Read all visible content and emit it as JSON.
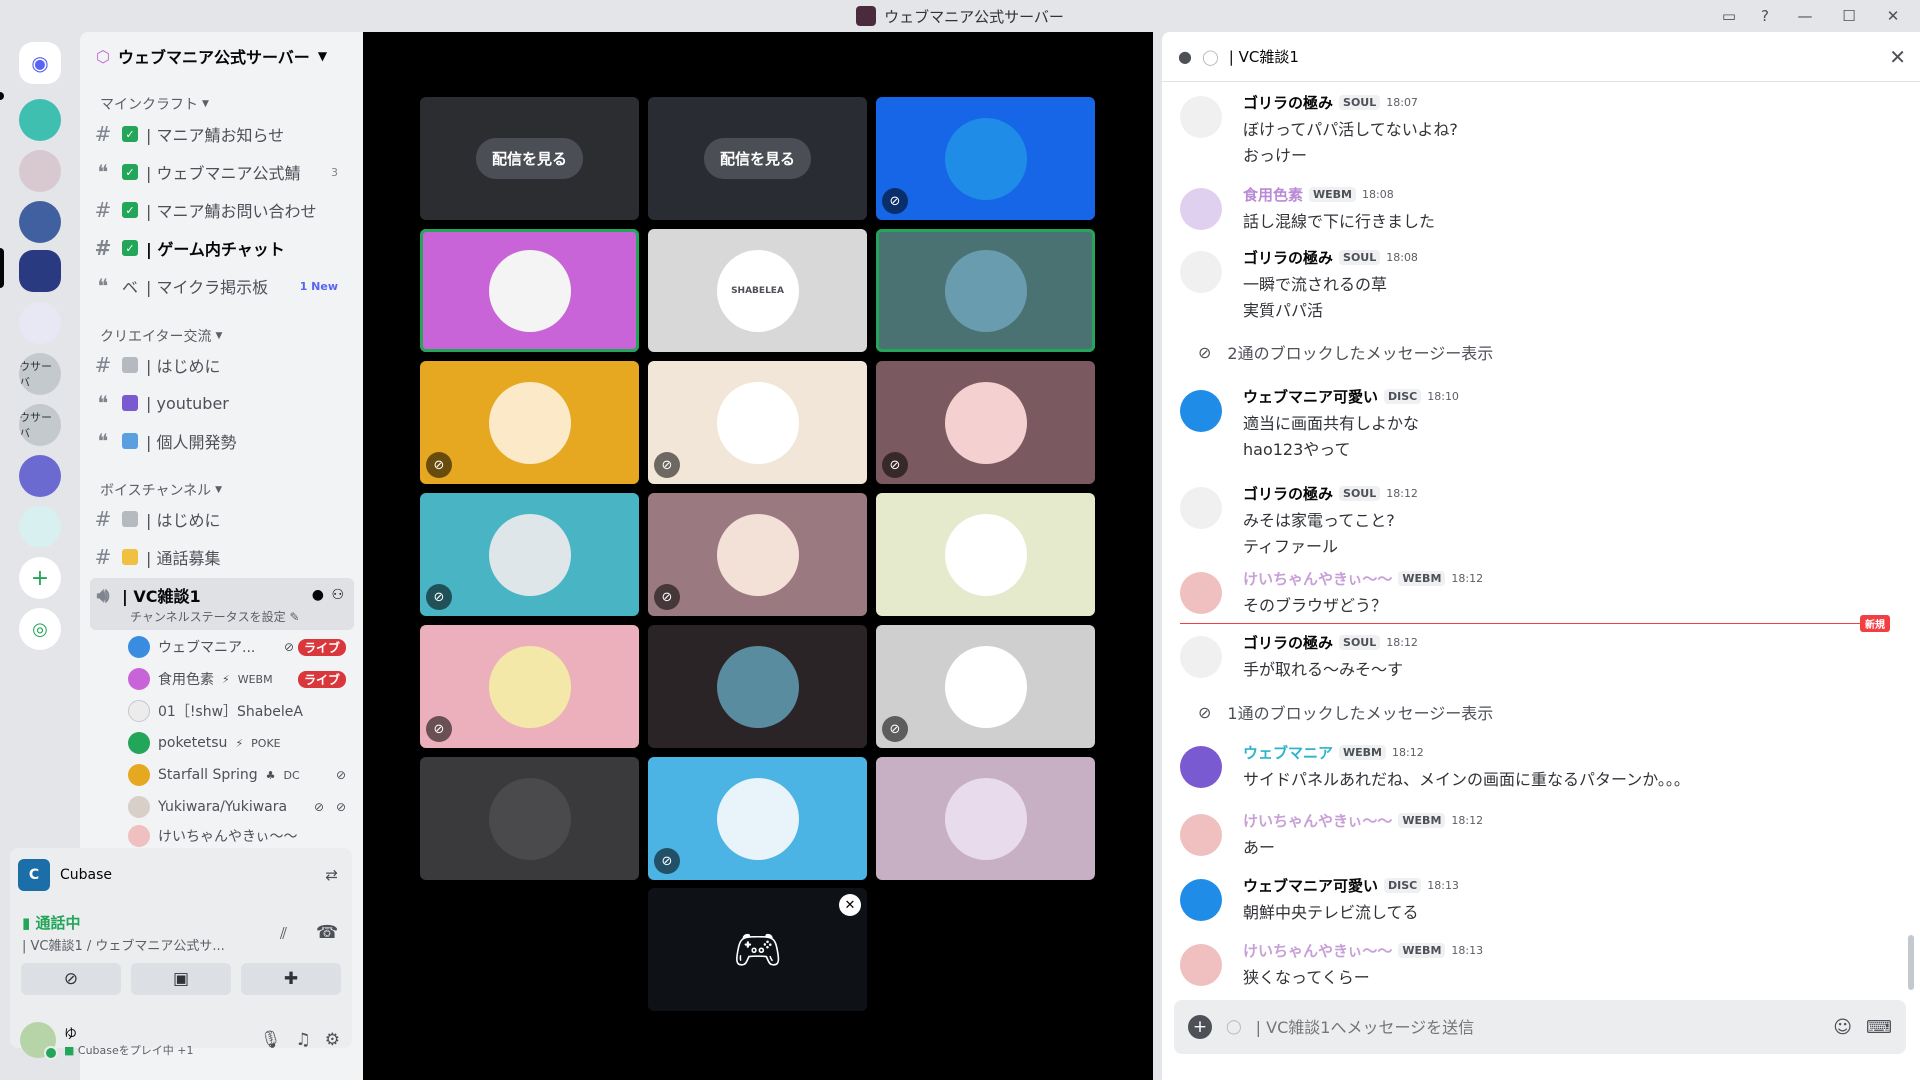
{
  "window": {
    "title": "ウェブマニア公式サーバー"
  },
  "rail": {
    "labels": [
      "ウサーバ",
      "ウサーバ"
    ]
  },
  "server": {
    "name": "ウェブマニア公式サーバー"
  },
  "categories": {
    "minecraft": "マインクラフト",
    "creator": "クリエイター交流",
    "voice": "ボイスチャンネル"
  },
  "channels": [
    {
      "label": "| マニア鯖お知らせ",
      "icon": "hash",
      "check": true
    },
    {
      "label": "| ウェブマニア公式鯖",
      "icon": "forum",
      "check": true,
      "count": "3"
    },
    {
      "label": "| マニア鯖お問い合わせ",
      "icon": "hash",
      "check": true
    },
    {
      "label": "| ゲーム内チャット",
      "icon": "hash",
      "check": true
    },
    {
      "label": "| マイクラ掲示板",
      "icon": "forum",
      "prefix": "ベ",
      "new": "1 New"
    },
    {
      "label": "| はじめに",
      "icon": "hash"
    },
    {
      "label": "| youtuber",
      "icon": "forum"
    },
    {
      "label": "| 個人開発勢",
      "icon": "forum"
    },
    {
      "label": "| はじめに",
      "icon": "hash"
    },
    {
      "label": "| 通話募集",
      "icon": "hash"
    }
  ],
  "voice_channel": {
    "name": "| VC雑談1",
    "status": "チャンネルステータスを設定"
  },
  "voice_users": [
    {
      "name": "ウェブマニア...",
      "live": "ライブ"
    },
    {
      "name": "食用色素",
      "tag": "WEBM",
      "live": "ライブ"
    },
    {
      "name": "01［!shw］ShabeleA"
    },
    {
      "name": "poketetsu",
      "tag": "POKE"
    },
    {
      "name": "Starfall Spring",
      "tag": "DC"
    },
    {
      "name": "Yukiwara/Yukiwara"
    },
    {
      "name": "けいちゃんやきぃ〜〜"
    }
  ],
  "activity": {
    "app": "Cubase"
  },
  "connection": {
    "status": "通話中",
    "channel": "| VC雑談1 / ウェブマニア公式サ..."
  },
  "user": {
    "name": "ゆ",
    "activity": "Cubaseをプレイ中 +1"
  },
  "stage": {
    "watch_label": "配信を見る",
    "tiles": [
      {
        "bg": "#2b2d31",
        "type": "watch"
      },
      {
        "bg": "#2a2c33",
        "type": "watch"
      },
      {
        "bg": "#1766e8",
        "type": "avatar",
        "avbg": "#1f8ce8",
        "mute": true
      },
      {
        "bg": "#c864d8",
        "type": "avatar",
        "avbg": "#f4f4f4",
        "speaking": true
      },
      {
        "bg": "#d8d8d8",
        "type": "avatar",
        "avbg": "#ffffff",
        "text": "SHABELEA"
      },
      {
        "bg": "#4a7272",
        "type": "avatar",
        "avbg": "#6a9cb0",
        "speaking": true
      },
      {
        "bg": "#e6a820",
        "type": "avatar",
        "avbg": "#fbe9c8",
        "mute": true
      },
      {
        "bg": "#f2e6d8",
        "type": "avatar",
        "avbg": "#ffffff",
        "mute": true
      },
      {
        "bg": "#7a5a60",
        "type": "avatar",
        "avbg": "#f4d0d0",
        "mute": true
      },
      {
        "bg": "#48b4c4",
        "type": "avatar",
        "avbg": "#dfe6ea",
        "mute": true
      },
      {
        "bg": "#9a7a80",
        "type": "avatar",
        "avbg": "#f3e1d8",
        "mute": true
      },
      {
        "bg": "#e6eacc",
        "type": "avatar",
        "avbg": "#ffffff"
      },
      {
        "bg": "#ecb0bc",
        "type": "avatar",
        "avbg": "#f4e8a8",
        "mute": true
      },
      {
        "bg": "#2a2426",
        "type": "avatar",
        "avbg": "#5a8ca0"
      },
      {
        "bg": "#cfcfcf",
        "type": "avatar",
        "avbg": "#ffffff",
        "mute": true
      },
      {
        "bg": "#3a3a3c",
        "type": "avatar",
        "avbg": "#4a4a4c"
      },
      {
        "bg": "#4cb4e4",
        "type": "avatar",
        "avbg": "#e8f4fa",
        "mute": true
      },
      {
        "bg": "#c8b0c4",
        "type": "avatar",
        "avbg": "#e8dcec"
      }
    ]
  },
  "chat": {
    "header": "| VC雑談1",
    "messages": [
      {
        "name": "ゴリラの極み",
        "color": "#060607",
        "tag": "SOUL",
        "time": "18:07",
        "lines": [
          "ぼけってパパ活してないよね?",
          "おっけー"
        ]
      },
      {
        "name": "食用色素",
        "color": "#b98bd6",
        "tag": "WEBM",
        "time": "18:08",
        "lines": [
          "話し混線で下に行きました"
        ]
      },
      {
        "name": "ゴリラの極み",
        "color": "#060607",
        "tag": "SOUL",
        "time": "18:08",
        "lines": [
          "一瞬で流されるの草",
          "実質パパ活"
        ]
      },
      {
        "name": "ウェブマニア可愛い",
        "color": "#060607",
        "tag": "DISC",
        "time": "18:10",
        "lines": [
          "適当に画面共有しよかな",
          "hao123やって"
        ]
      },
      {
        "name": "ゴリラの極み",
        "color": "#060607",
        "tag": "SOUL",
        "time": "18:12",
        "lines": [
          "みそは家電ってこと?",
          "ティファール"
        ]
      },
      {
        "name": "けいちゃんやきぃ〜〜",
        "color": "#c8a0d8",
        "tag": "WEBM",
        "time": "18:12",
        "lines": [
          "そのブラウザどう？"
        ]
      },
      {
        "name": "ゴリラの極み",
        "color": "#060607",
        "tag": "SOUL",
        "time": "18:12",
        "lines": [
          "手が取れる〜みそ〜す"
        ]
      },
      {
        "name": "ウェブマニア",
        "color": "#2fb3c8",
        "tag": "WEBM",
        "time": "18:12",
        "lines": [
          "サイドパネルあれだね、メインの画面に重なるパターンか。。。"
        ]
      },
      {
        "name": "けいちゃんやきぃ〜〜",
        "color": "#c8a0d8",
        "tag": "WEBM",
        "time": "18:12",
        "lines": [
          "あー"
        ]
      },
      {
        "name": "ウェブマニア可愛い",
        "color": "#060607",
        "tag": "DISC",
        "time": "18:13",
        "lines": [
          "朝鮮中央テレビ流してる"
        ]
      },
      {
        "name": "けいちゃんやきぃ〜〜",
        "color": "#c8a0d8",
        "tag": "WEBM",
        "time": "18:13",
        "lines": [
          "狭くなってくらー"
        ]
      }
    ],
    "blocked": [
      "2通のブロックしたメッセージー表示",
      "1通のブロックしたメッセージー表示"
    ],
    "new_label": "新規",
    "placeholder": "| VC雑談1へメッセージを送信"
  }
}
